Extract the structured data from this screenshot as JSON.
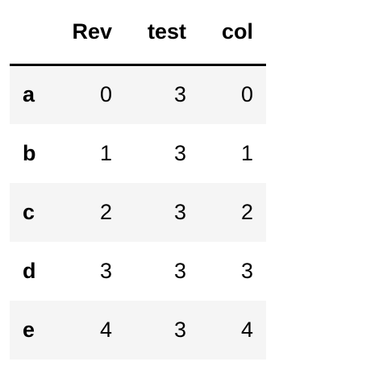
{
  "table": {
    "columns": [
      "",
      "Rev",
      "test",
      "col"
    ],
    "rows": [
      {
        "index": "a",
        "values": [
          "0",
          "3",
          "0"
        ]
      },
      {
        "index": "b",
        "values": [
          "1",
          "3",
          "1"
        ]
      },
      {
        "index": "c",
        "values": [
          "2",
          "3",
          "2"
        ]
      },
      {
        "index": "d",
        "values": [
          "3",
          "3",
          "3"
        ]
      },
      {
        "index": "e",
        "values": [
          "4",
          "3",
          "4"
        ]
      }
    ]
  }
}
